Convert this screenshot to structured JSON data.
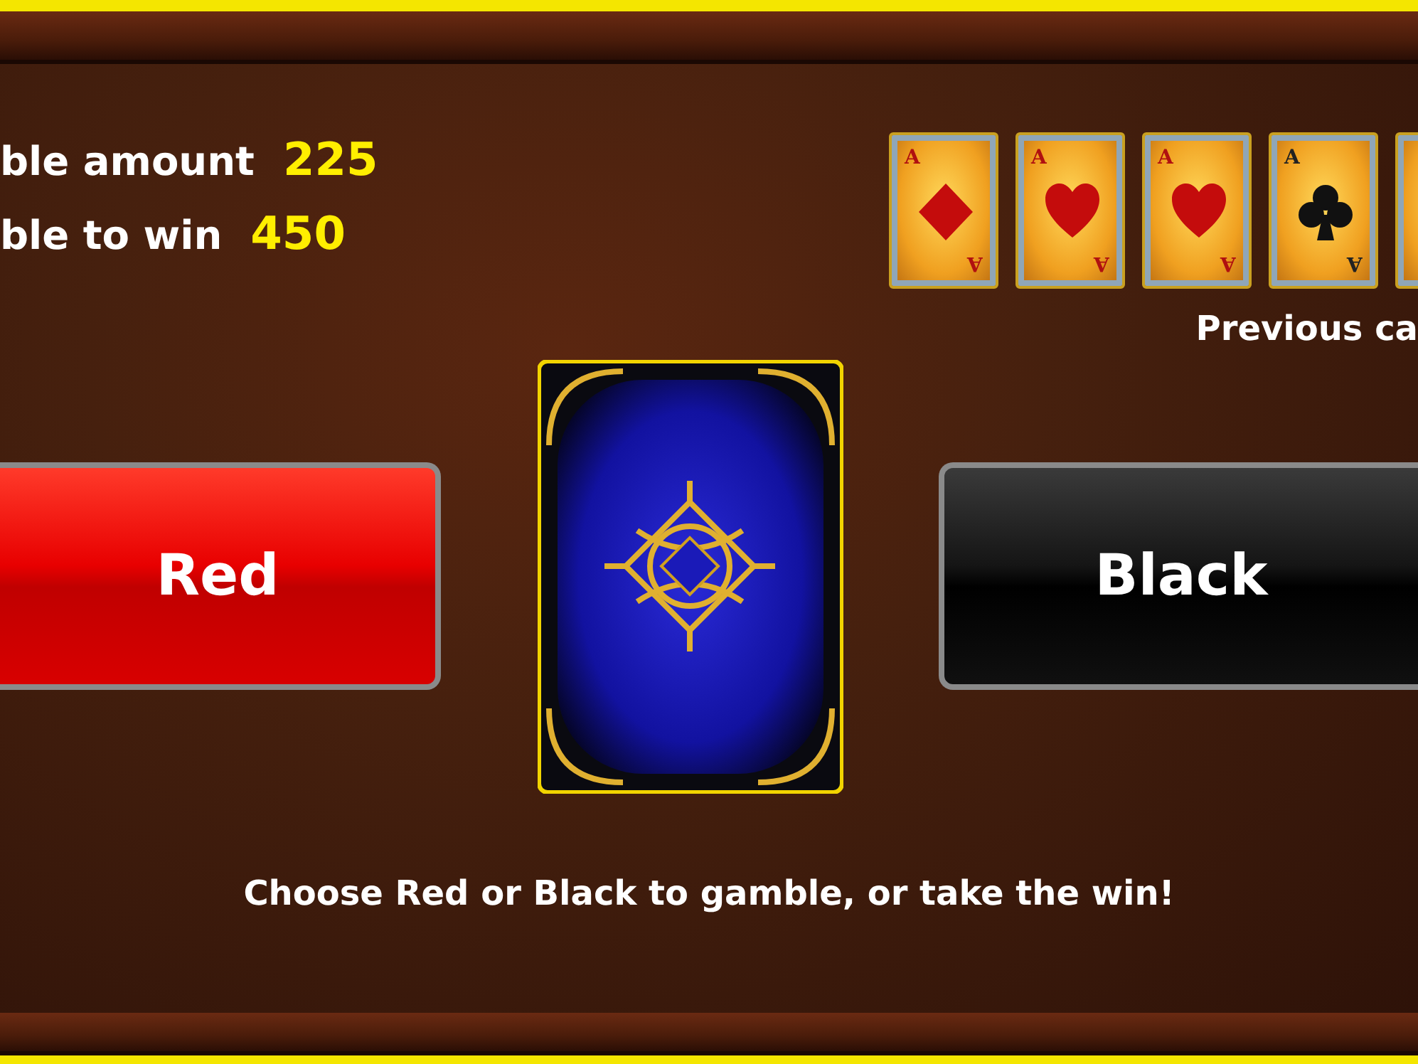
{
  "stats": [
    {
      "label": "ble amount",
      "value": "225"
    },
    {
      "label": "ble to win",
      "value": "450"
    }
  ],
  "previous_cards": [
    {
      "kind": "diamond",
      "rank_top": "A",
      "rank_bottom": "A"
    },
    {
      "kind": "heart",
      "rank_top": "A",
      "rank_bottom": "A"
    },
    {
      "kind": "heart",
      "rank_top": "A",
      "rank_bottom": "A"
    },
    {
      "kind": "club",
      "rank_top": "A",
      "rank_bottom": "A"
    },
    {
      "kind": "cut"
    }
  ],
  "previous_label": "Previous ca",
  "buttons": [
    {
      "kind": "red",
      "label": "Red"
    },
    {
      "kind": "black",
      "label": "Black"
    }
  ],
  "message": "Choose Red or Black to gamble, or take the win!"
}
